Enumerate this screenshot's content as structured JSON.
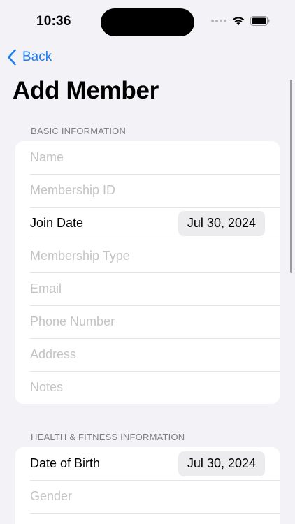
{
  "status_bar": {
    "time": "10:36"
  },
  "nav": {
    "back_label": "Back"
  },
  "page": {
    "title": "Add Member"
  },
  "sections": {
    "basic": {
      "header": "BASIC INFORMATION",
      "name_placeholder": "Name",
      "membership_id_placeholder": "Membership ID",
      "join_date_label": "Join Date",
      "join_date_value": "Jul 30, 2024",
      "membership_type_placeholder": "Membership Type",
      "email_placeholder": "Email",
      "phone_placeholder": "Phone Number",
      "address_placeholder": "Address",
      "notes_placeholder": "Notes"
    },
    "health": {
      "header": "HEALTH & FITNESS INFORMATION",
      "dob_label": "Date of Birth",
      "dob_value": "Jul 30, 2024",
      "gender_placeholder": "Gender"
    }
  },
  "colors": {
    "accent": "#1a7cf0",
    "background": "#f2f2f7",
    "placeholder": "#c4c4c7"
  },
  "icons": {
    "back": "chevron-left-icon",
    "wifi": "wifi-icon",
    "battery": "battery-icon",
    "signal": "cellular-signal-icon"
  }
}
